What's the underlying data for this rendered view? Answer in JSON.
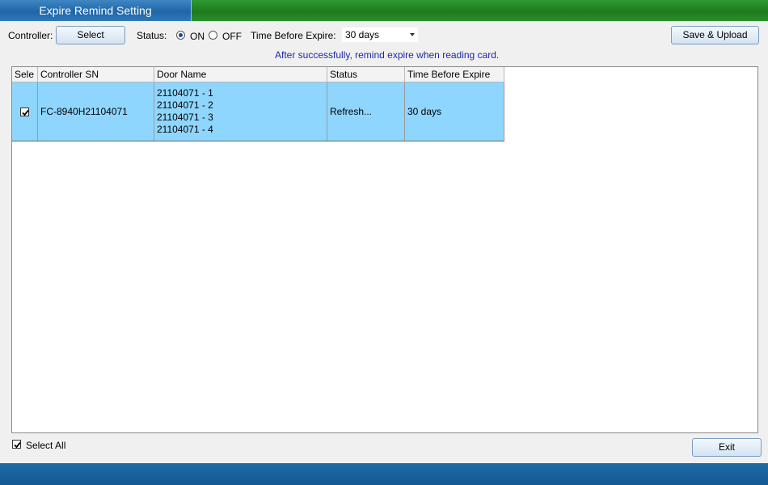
{
  "window": {
    "title": "Expire Remind Setting"
  },
  "toolbar": {
    "controller_label": "Controller:",
    "select_button": "Select",
    "status_label": "Status:",
    "status_on": "ON",
    "status_off": "OFF",
    "status_selected": "ON",
    "time_label": "Time Before Expire:",
    "time_value": "30 days",
    "save_upload_button": "Save & Upload"
  },
  "notice": "After successfully, remind expire when reading card.",
  "table": {
    "columns": [
      "Sele",
      "Controller SN",
      "Door Name",
      "Status",
      "Time Before Expire"
    ],
    "rows": [
      {
        "selected": true,
        "controller_sn": "FC-8940H21104071",
        "doors": [
          "21104071 - 1",
          "21104071 - 2",
          "21104071 - 3",
          "21104071 - 4"
        ],
        "status": "Refresh...",
        "time_before_expire": "30 days"
      }
    ]
  },
  "bottom": {
    "select_all_label": "Select All",
    "select_all_checked": true,
    "exit_button": "Exit"
  },
  "colors": {
    "title_tab": "#1f66a8",
    "title_bar": "#1d7a1d",
    "selected_row": "#8fd6ff",
    "notice_text": "#1a2aa8",
    "footer": "#135a93"
  }
}
